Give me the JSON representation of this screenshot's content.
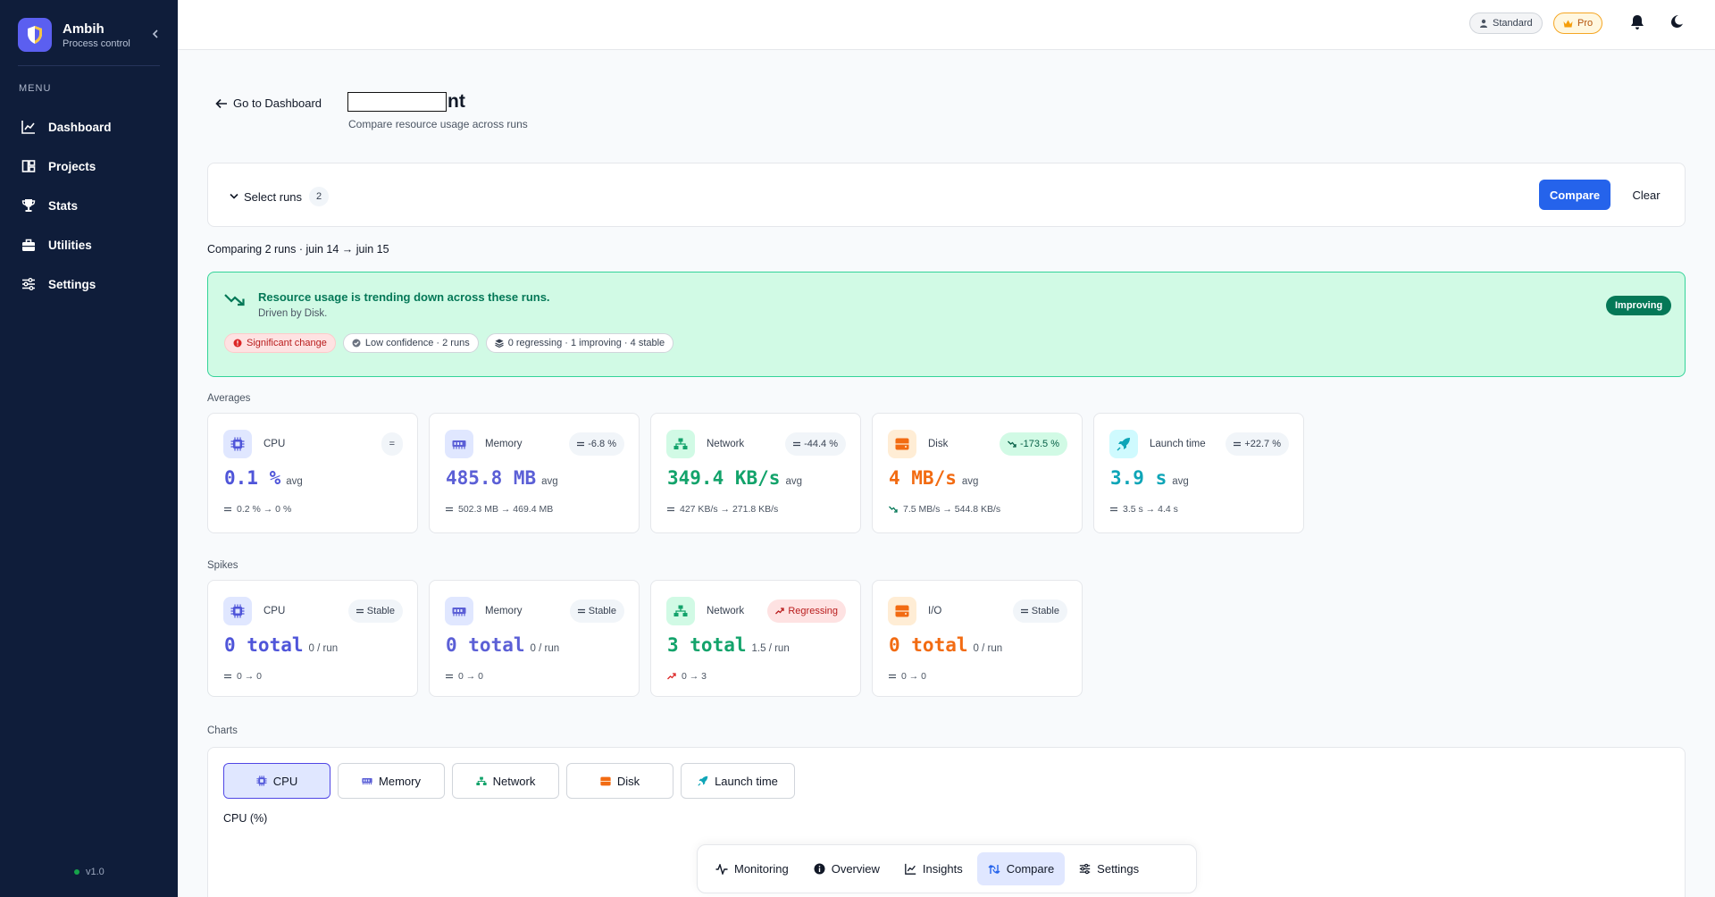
{
  "sidebar": {
    "brand_name": "Ambih",
    "brand_sub": "Process control",
    "menu_label": "MENU",
    "items": [
      {
        "label": "Dashboard",
        "icon": "chart-line-icon"
      },
      {
        "label": "Projects",
        "icon": "projects-icon"
      },
      {
        "label": "Stats",
        "icon": "trophy-icon"
      },
      {
        "label": "Utilities",
        "icon": "toolbox-icon"
      },
      {
        "label": "Settings",
        "icon": "sliders-icon"
      }
    ],
    "version": "v1.0"
  },
  "topbar": {
    "standard_label": "Standard",
    "pro_label": "Pro"
  },
  "header": {
    "back_label": "Go to Dashboard",
    "title_suffix": "nt",
    "subtitle": "Compare resource usage across runs"
  },
  "select_runs": {
    "label": "Select runs",
    "count": "2",
    "compare_label": "Compare",
    "clear_label": "Clear"
  },
  "comparing_text": "Comparing 2 runs · juin 14 → juin 15",
  "trend": {
    "title": "Resource usage is trending down across these runs.",
    "subtitle": "Driven by Disk.",
    "badge": "Improving",
    "tags": [
      "Significant change",
      "Low confidence · 2 runs",
      "0 regressing · 1 improving · 4 stable"
    ]
  },
  "averages": {
    "label": "Averages",
    "cards": [
      {
        "name": "CPU",
        "badge": "=",
        "value": "0.1 %",
        "unit": "avg",
        "delta": "0.2 % → 0 %"
      },
      {
        "name": "Memory",
        "badge": "-6.8 %",
        "value": "485.8 MB",
        "unit": "avg",
        "delta": "502.3 MB → 469.4 MB"
      },
      {
        "name": "Network",
        "badge": "-44.4 %",
        "value": "349.4 KB/s",
        "unit": "avg",
        "delta": "427 KB/s → 271.8 KB/s"
      },
      {
        "name": "Disk",
        "badge": "-173.5 %",
        "value": "4 MB/s",
        "unit": "avg",
        "delta": "7.5 MB/s → 544.8 KB/s"
      },
      {
        "name": "Launch time",
        "badge": "+22.7 %",
        "value": "3.9 s",
        "unit": "avg",
        "delta": "3.5 s → 4.4 s"
      }
    ]
  },
  "spikes": {
    "label": "Spikes",
    "cards": [
      {
        "name": "CPU",
        "badge": "Stable",
        "value": "0 total",
        "unit": "0 / run",
        "delta": "0 → 0"
      },
      {
        "name": "Memory",
        "badge": "Stable",
        "value": "0 total",
        "unit": "0 / run",
        "delta": "0 → 0"
      },
      {
        "name": "Network",
        "badge": "Regressing",
        "value": "3 total",
        "unit": "1.5 / run",
        "delta": "0 → 3"
      },
      {
        "name": "I/O",
        "badge": "Stable",
        "value": "0 total",
        "unit": "0 / run",
        "delta": "0 → 0"
      }
    ]
  },
  "charts": {
    "label": "Charts",
    "tabs": [
      "CPU",
      "Memory",
      "Network",
      "Disk",
      "Launch time"
    ],
    "active_title": "CPU (%)"
  },
  "bottom_nav": [
    "Monitoring",
    "Overview",
    "Insights",
    "Compare",
    "Settings"
  ],
  "colors": {
    "sidebar_bg": "#0f1d3a",
    "accent": "#2563eb",
    "success": "#047857",
    "cpu": "#4f55d9",
    "network": "#13a36b",
    "disk": "#f26b12",
    "launch": "#0ea5b7"
  }
}
